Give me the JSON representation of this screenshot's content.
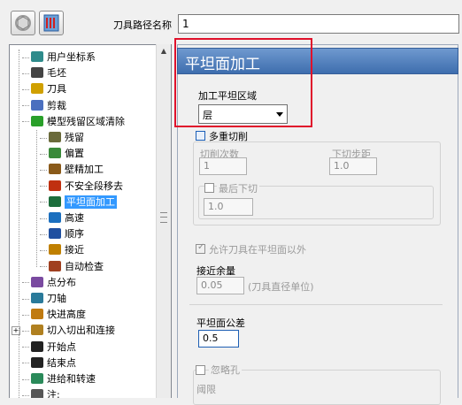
{
  "toolbar": {
    "name_label": "刀具路径名称",
    "name_value": "1"
  },
  "tree": {
    "items": [
      {
        "label": "用户坐标系",
        "icon": "ucs-icon",
        "color": "#2e8b8b",
        "level": 1
      },
      {
        "label": "毛坯",
        "icon": "stock-icon",
        "color": "#444444",
        "level": 1
      },
      {
        "label": "刀具",
        "icon": "tool-icon",
        "color": "#d0a000",
        "level": 1
      },
      {
        "label": "剪裁",
        "icon": "trim-icon",
        "color": "#4b6fbf",
        "level": 1
      },
      {
        "label": "模型残留区域清除",
        "icon": "model-rest-icon",
        "color": "#2aa02a",
        "level": 1
      },
      {
        "label": "残留",
        "icon": "rest-icon",
        "color": "#6a6a3a",
        "level": 2
      },
      {
        "label": "偏置",
        "icon": "offset-icon",
        "color": "#3a8a3a",
        "level": 2
      },
      {
        "label": "壁精加工",
        "icon": "wall-finish-icon",
        "color": "#8a5a1a",
        "level": 2
      },
      {
        "label": "不安全段移去",
        "icon": "unsafe-segment-icon",
        "color": "#c03010",
        "level": 2
      },
      {
        "label": "平坦面加工",
        "icon": "flat-machining-icon",
        "color": "#1c6e3c",
        "level": 2,
        "selected": true
      },
      {
        "label": "高速",
        "icon": "high-speed-icon",
        "color": "#1b6fbf",
        "level": 2
      },
      {
        "label": "顺序",
        "icon": "order-icon",
        "color": "#2050a0",
        "level": 2
      },
      {
        "label": "接近",
        "icon": "approach-icon",
        "color": "#c08000",
        "level": 2
      },
      {
        "label": "自动检查",
        "icon": "auto-check-icon",
        "color": "#a04020",
        "level": 2
      },
      {
        "label": "点分布",
        "icon": "point-distribution-icon",
        "color": "#7a4aa0",
        "level": 1
      },
      {
        "label": "刀轴",
        "icon": "tool-axis-icon",
        "color": "#2a7a9a",
        "level": 1
      },
      {
        "label": "快进高度",
        "icon": "rapid-height-icon",
        "color": "#c07a10",
        "level": 1
      },
      {
        "label": "切入切出和连接",
        "icon": "leads-links-icon",
        "color": "#b08020",
        "level": 1,
        "expandable": true
      },
      {
        "label": "开始点",
        "icon": "start-point-icon",
        "color": "#222222",
        "level": 1
      },
      {
        "label": "结束点",
        "icon": "end-point-icon",
        "color": "#222222",
        "level": 1
      },
      {
        "label": "进给和转速",
        "icon": "feeds-speeds-icon",
        "color": "#2a8a5a",
        "level": 1
      },
      {
        "label": "注:",
        "icon": "notes-icon",
        "color": "#555555",
        "level": 1
      }
    ]
  },
  "panel": {
    "title": "平坦面加工",
    "area_label": "加工平坦区域",
    "area_value": "层",
    "multi_cut_label": "多重切削",
    "cut_count_label": "切削次数",
    "cut_count_value": "1",
    "step_down_label": "下切步距",
    "step_down_value": "1.0",
    "final_cut_label": "最后下切",
    "final_cut_value": "1.0",
    "allow_outside_label": "允许刀具在平坦面以外",
    "approach_allowance_label": "接近余量",
    "approach_allowance_value": "0.05",
    "approach_allowance_unit": "(刀具直径单位)",
    "flat_tolerance_label": "平坦面公差",
    "flat_tolerance_value": "0.5",
    "ignore_holes_label": "忽略孔",
    "threshold_label": "阈限"
  },
  "colors": {
    "header_blue": "#4f7dbd",
    "selection": "#3399ff",
    "highlight_red": "#e0112b"
  }
}
